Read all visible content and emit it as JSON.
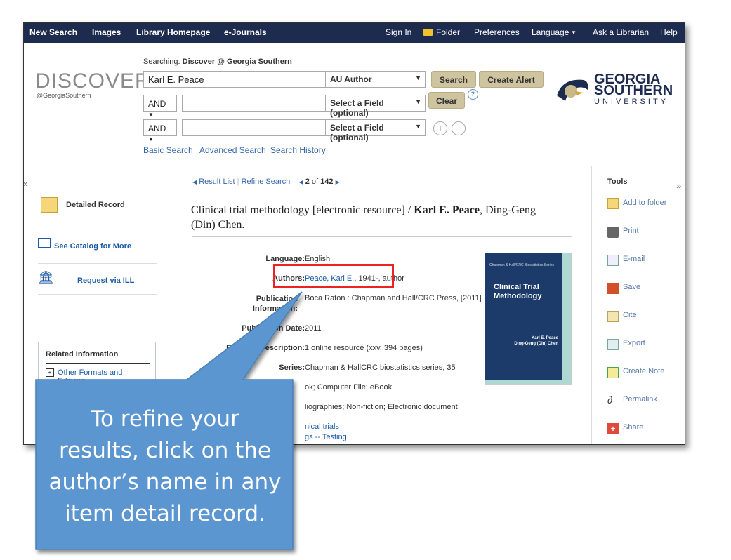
{
  "topnav": {
    "left": [
      "New Search",
      "Images",
      "Library Homepage",
      "e-Journals"
    ],
    "sign_in": "Sign In",
    "folder": "Folder",
    "preferences": "Preferences",
    "language": "Language",
    "ask": "Ask a Librarian",
    "help": "Help"
  },
  "header": {
    "logo_main": "DISCOVER",
    "logo_sub": "@GeorgiaSouthern",
    "searching_prefix": "Searching:",
    "searching_target": "Discover @ Georgia Southern",
    "query1": "Karl E. Peace",
    "field1": "AU Author",
    "bool2": "AND",
    "field2": "Select a Field (optional)",
    "bool3": "AND",
    "field3": "Select a Field (optional)",
    "search_btn": "Search",
    "create_alert_btn": "Create Alert",
    "clear_btn": "Clear",
    "help_icon": "?",
    "plus": "+",
    "minus": "−",
    "links": [
      "Basic Search",
      "Advanced Search",
      "Search History"
    ],
    "gs_line1": "GEORGIA",
    "gs_line2": "SOUTHERN",
    "gs_line3": "UNIVERSITY"
  },
  "left": {
    "collapse": "«",
    "detailed_record": "Detailed Record",
    "see_catalog": "See Catalog for More",
    "request_ill": "Request via ILL",
    "related_header": "Related Information",
    "other_formats": "Other Formats and Editions"
  },
  "main": {
    "result_list": "Result List",
    "refine_search": "Refine Search",
    "position_current": "2",
    "position_of": "of",
    "position_total": "142",
    "title_plain": "Clinical trial methodology [electronic resource] / ",
    "title_bold": "Karl E. Peace",
    "title_rest": ", Ding-Geng (Din) Chen.",
    "fields": [
      {
        "label": "Language:",
        "value": "English"
      },
      {
        "label": "Authors:",
        "link": "Peace, Karl E.",
        "value": ", 1941-, author"
      },
      {
        "label": "Publication Information:",
        "value": "Boca Raton : Chapman and Hall/CRC Press, [2011]"
      },
      {
        "label": "Publication Date:",
        "value": "2011"
      },
      {
        "label": "Physical Description:",
        "value": "1 online resource (xxv, 394 pages)"
      },
      {
        "label": "Series:",
        "value": "Chapman & HallCRC biostatistics series; 35"
      },
      {
        "label": "",
        "value": "ok; Computer File; eBook"
      },
      {
        "label": "",
        "value": "liographies; Non-fiction; Electronic document"
      },
      {
        "label": "",
        "link": "nical trials"
      },
      {
        "label": "",
        "link": "gs -- Testing"
      }
    ],
    "cover_series": "Chapman & Hall/CRC Biostatistics Series",
    "cover_title": "Clinical Trial Methodology",
    "cover_author1": "Karl E. Peace",
    "cover_author2": "Ding-Geng (Din) Chen"
  },
  "tools": {
    "expand": "»",
    "header": "Tools",
    "items": [
      "Add to folder",
      "Print",
      "E-mail",
      "Save",
      "Cite",
      "Export",
      "Create Note",
      "Permalink",
      "Share"
    ]
  },
  "callout": {
    "line1": "To refine your",
    "line2": "results, click on the",
    "line3": "author’s name in any",
    "line4": "item detail record."
  }
}
